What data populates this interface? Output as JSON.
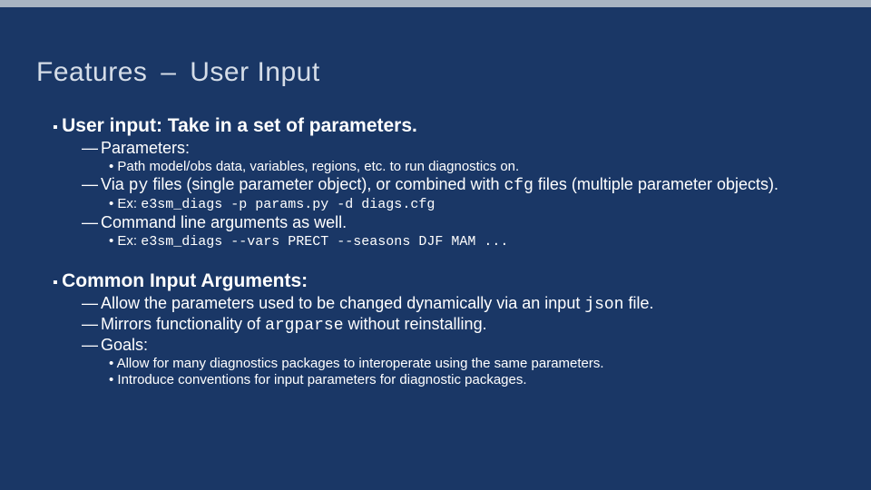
{
  "title_part1": "Features",
  "title_sep": "–",
  "title_part2": "User Input",
  "b1": {
    "heading": "User input: Take in a set of parameters.",
    "s1": "Parameters:",
    "s1_a": "Path model/obs data, variables, regions, etc. to run diagnostics on.",
    "s2_pre": "Via ",
    "s2_code1": "py",
    "s2_mid": " files (single parameter object), or combined with ",
    "s2_code2": "cfg",
    "s2_post": " files (multiple parameter objects).",
    "s2_a_pre": "Ex: ",
    "s2_a_code": "e3sm_diags -p params.py -d diags.cfg",
    "s3": "Command line arguments as well.",
    "s3_a_pre": "Ex: ",
    "s3_a_code": "e3sm_diags --vars PRECT --seasons DJF MAM ..."
  },
  "b2": {
    "heading": "Common Input Arguments:",
    "s1_pre": "Allow the parameters used to be changed dynamically via an input ",
    "s1_code": "json",
    "s1_post": " file.",
    "s2_pre": "Mirrors functionality of ",
    "s2_code": "argparse",
    "s2_post": " without reinstalling.",
    "s3": "Goals:",
    "s3_a": "Allow for many diagnostics packages to interoperate using the same parameters.",
    "s3_b": "Introduce conventions for input parameters for diagnostic packages."
  }
}
